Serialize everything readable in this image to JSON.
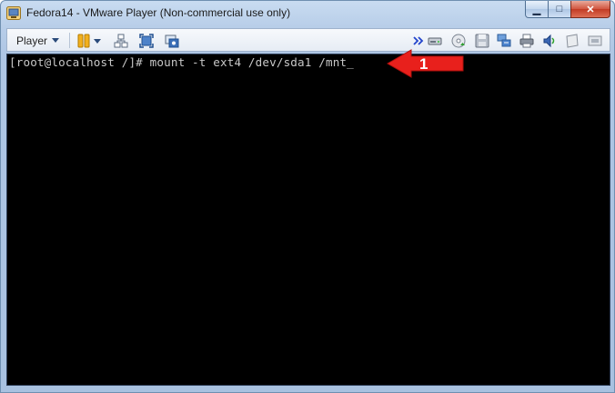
{
  "window": {
    "title": "Fedora14 - VMware Player (Non-commercial use only)",
    "caption_buttons": {
      "minimize": "▁",
      "maximize": "□",
      "close": "✕"
    }
  },
  "toolbar": {
    "player_menu_label": "Player",
    "left_icons": [
      "pause-icon",
      "dropdown-caret-icon",
      "send-ctrl-alt-del-icon",
      "full-screen-icon",
      "unity-icon"
    ],
    "right_icons": [
      "double-chevron-icon",
      "hard-disk-icon",
      "cd-dvd-icon",
      "floppy-icon",
      "network-adapter-icon",
      "printer-icon",
      "sound-card-icon",
      "message-icon",
      "display-icon"
    ]
  },
  "console": {
    "prompt": "[root@localhost /]# ",
    "command": "mount -t ext4 /dev/sda1 /mnt",
    "cursor": "_"
  },
  "annotation": {
    "number": "1",
    "colors": {
      "arrow": "#e8201c",
      "number_text": "#ffffff"
    }
  },
  "colors": {
    "frame": "#b7cde8",
    "console_bg": "#000000",
    "console_text": "#c8c8c8"
  }
}
